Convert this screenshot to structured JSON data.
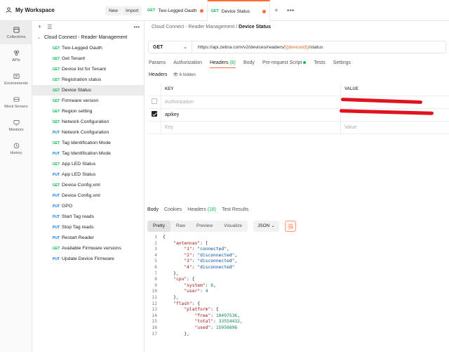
{
  "workspace": {
    "name": "My Workspace",
    "new_label": "New",
    "import_label": "Import"
  },
  "tabs": [
    {
      "method": "GET",
      "label": "Two-Legged Oauth",
      "unsaved": true,
      "active": false
    },
    {
      "method": "GET",
      "label": "Device Status",
      "unsaved": true,
      "active": true
    }
  ],
  "rail": [
    {
      "label": "Collections",
      "icon": "collections-icon",
      "active": true
    },
    {
      "label": "APIs",
      "icon": "apis-icon"
    },
    {
      "label": "Environments",
      "icon": "environments-icon"
    },
    {
      "label": "Mock Servers",
      "icon": "mock-servers-icon"
    },
    {
      "label": "Monitors",
      "icon": "monitors-icon"
    },
    {
      "label": "History",
      "icon": "history-icon"
    }
  ],
  "collection": {
    "name": "Cloud Connect - Reader Management",
    "requests": [
      {
        "method": "GET",
        "label": "Two-Legged Oauth"
      },
      {
        "method": "GET",
        "label": "Get Tenant"
      },
      {
        "method": "GET",
        "label": "Device list for Tenant"
      },
      {
        "method": "GET",
        "label": "Registration status"
      },
      {
        "method": "GET",
        "label": "Device Status"
      },
      {
        "method": "GET",
        "label": "Firmware version"
      },
      {
        "method": "GET",
        "label": "Region setting"
      },
      {
        "method": "GET",
        "label": "Network Configuration"
      },
      {
        "method": "PUT",
        "label": "Network Configuration"
      },
      {
        "method": "GET",
        "label": "Tag Identification Mode"
      },
      {
        "method": "PUT",
        "label": "Tag Identification Mode"
      },
      {
        "method": "GET",
        "label": "App LED Status"
      },
      {
        "method": "PUT",
        "label": "App LED Status"
      },
      {
        "method": "GET",
        "label": "Device Config.xml"
      },
      {
        "method": "PUT",
        "label": "Device Config.xml"
      },
      {
        "method": "PUT",
        "label": "GPO"
      },
      {
        "method": "PUT",
        "label": "Start Tag reads"
      },
      {
        "method": "PUT",
        "label": "Stop Tag reads"
      },
      {
        "method": "PUT",
        "label": "Restart Reader"
      },
      {
        "method": "GET",
        "label": "Available Firmware versions"
      },
      {
        "method": "PUT",
        "label": "Update Device Firmware"
      }
    ]
  },
  "breadcrumb": {
    "parent": "Cloud Connect - Reader Management",
    "sep": "/",
    "current": "Device Status"
  },
  "request": {
    "method": "GET",
    "url_prefix": "https://api.zebra.com/v2/devices/readers/",
    "url_var": "{{deviceId}}",
    "url_suffix": "/status"
  },
  "request_tabs": {
    "params": "Params",
    "authorization": "Authorization",
    "headers": "Headers",
    "headers_count": "(8)",
    "body": "Body",
    "prerequest": "Pre-request Script",
    "tests": "Tests",
    "settings": "Settings"
  },
  "headers_sub": {
    "label": "Headers",
    "hidden": "6 hidden"
  },
  "headers_table": {
    "key_col": "KEY",
    "value_col": "VALUE",
    "rows": [
      {
        "key": "Authorization",
        "checked": false
      },
      {
        "key": "apikey",
        "checked": true
      }
    ],
    "key_placeholder": "Key",
    "value_placeholder": "Value"
  },
  "response_tabs": {
    "body": "Body",
    "cookies": "Cookies",
    "headers": "Headers",
    "headers_count": "(18)",
    "tests": "Test Results"
  },
  "response_tools": {
    "pretty": "Pretty",
    "raw": "Raw",
    "preview": "Preview",
    "visualize": "Visualize",
    "format": "JSON"
  },
  "response_body": [
    {
      "n": "1",
      "text": "{"
    },
    {
      "n": "2",
      "text": "    \"antennas\": ["
    },
    {
      "n": "3",
      "text": "        \"1\": \"connected\","
    },
    {
      "n": "4",
      "text": "        \"2\": \"disconnected\","
    },
    {
      "n": "5",
      "text": "        \"3\": \"disconnected\","
    },
    {
      "n": "6",
      "text": "        \"4\": \"disconnected\""
    },
    {
      "n": "7",
      "text": "    },"
    },
    {
      "n": "8",
      "text": "    \"cpu\": {"
    },
    {
      "n": "9",
      "text": "        \"system\": 8,"
    },
    {
      "n": "10",
      "text": "        \"user\": 4"
    },
    {
      "n": "11",
      "text": "    },"
    },
    {
      "n": "12",
      "text": "    \"flash\": {"
    },
    {
      "n": "13",
      "text": "        \"platform\": {"
    },
    {
      "n": "14",
      "text": "            \"free\": 10497536,"
    },
    {
      "n": "15",
      "text": "            \"total\": 33554432,"
    },
    {
      "n": "16",
      "text": "            \"used\": 15056896"
    },
    {
      "n": "17",
      "text": "        },"
    }
  ]
}
